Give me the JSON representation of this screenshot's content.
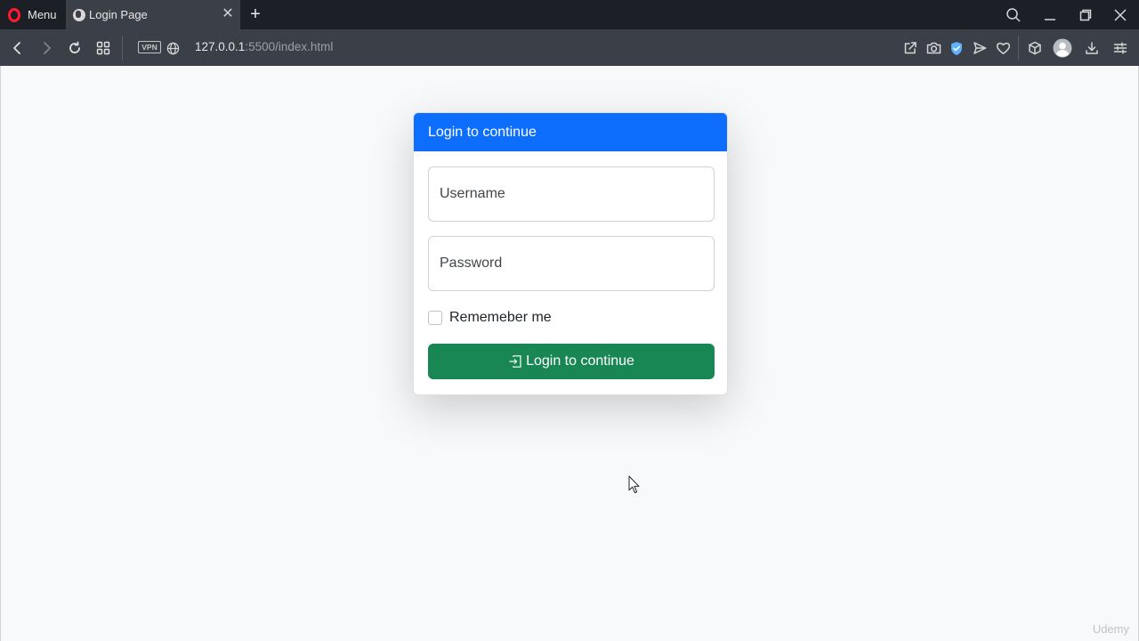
{
  "browser": {
    "menu_label": "Menu",
    "tab_title": "Login Page",
    "vpn_label": "VPN",
    "url_host": "127.0.0.1",
    "url_rest": ":5500/index.html"
  },
  "card": {
    "header": "Login to continue",
    "username_placeholder": "Username",
    "password_placeholder": "Password",
    "remember_label": "Rememeber me",
    "button_label": "Login to continue",
    "colors": {
      "header_bg": "#0d6efd",
      "button_bg": "#198754"
    }
  },
  "watermark": "Udemy"
}
